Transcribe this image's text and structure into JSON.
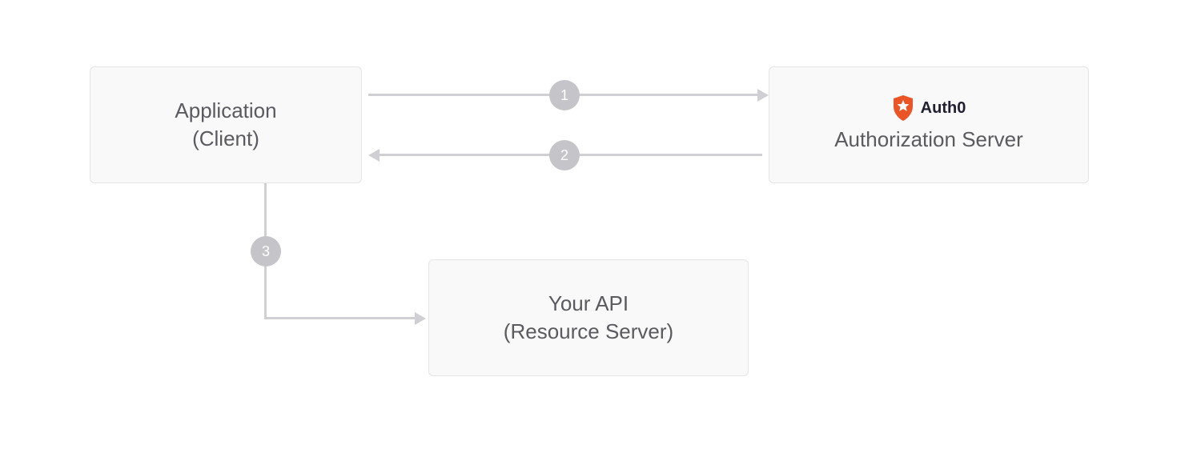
{
  "nodes": {
    "client": {
      "title": "Application",
      "subtitle": "(Client)"
    },
    "authz": {
      "logo_label": "Auth0",
      "title": "Authorization Server"
    },
    "api": {
      "title": "Your API",
      "subtitle": "(Resource Server)"
    }
  },
  "steps": {
    "s1": "1",
    "s2": "2",
    "s3": "3"
  },
  "colors": {
    "box_bg": "#f9f9fa",
    "box_border": "#e5e5e7",
    "text": "#5a5a5f",
    "arrow": "#d0d0d4",
    "badge": "#c5c5c9",
    "logo": "#eb5424",
    "auth0_text": "#202030"
  }
}
